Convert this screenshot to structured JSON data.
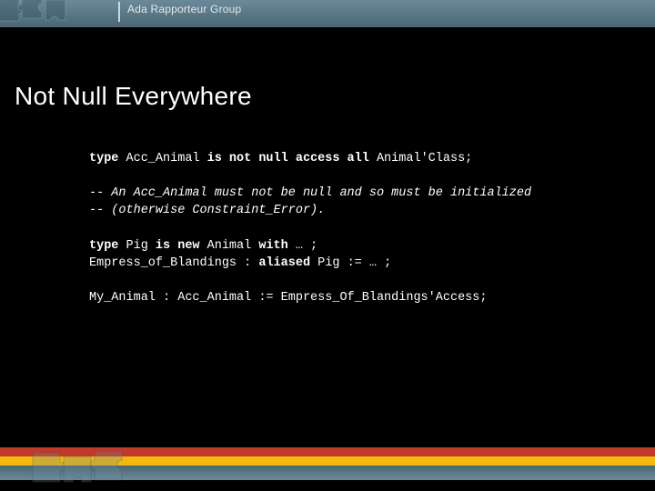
{
  "header": {
    "group_label": "Ada Rapporteur Group"
  },
  "slide": {
    "title": "Not Null Everywhere"
  },
  "code": {
    "line1_a": "type",
    "line1_b": " Acc_Animal ",
    "line1_c": "is not null access all",
    "line1_d": " Animal'Class;",
    "comment1": "-- An Acc_Animal must not be null and so must be initialized",
    "comment2": "-- (otherwise Constraint_Error).",
    "line4_a": "type",
    "line4_b": " Pig ",
    "line4_c": "is new",
    "line4_d": " Animal ",
    "line4_e": "with",
    "line4_f": " … ;",
    "line5_a": "Empress_of_Blandings : ",
    "line5_b": "aliased",
    "line5_c": " Pig := … ;",
    "line6": "My_Animal : Acc_Animal := Empress_Of_Blandings'Access;"
  }
}
